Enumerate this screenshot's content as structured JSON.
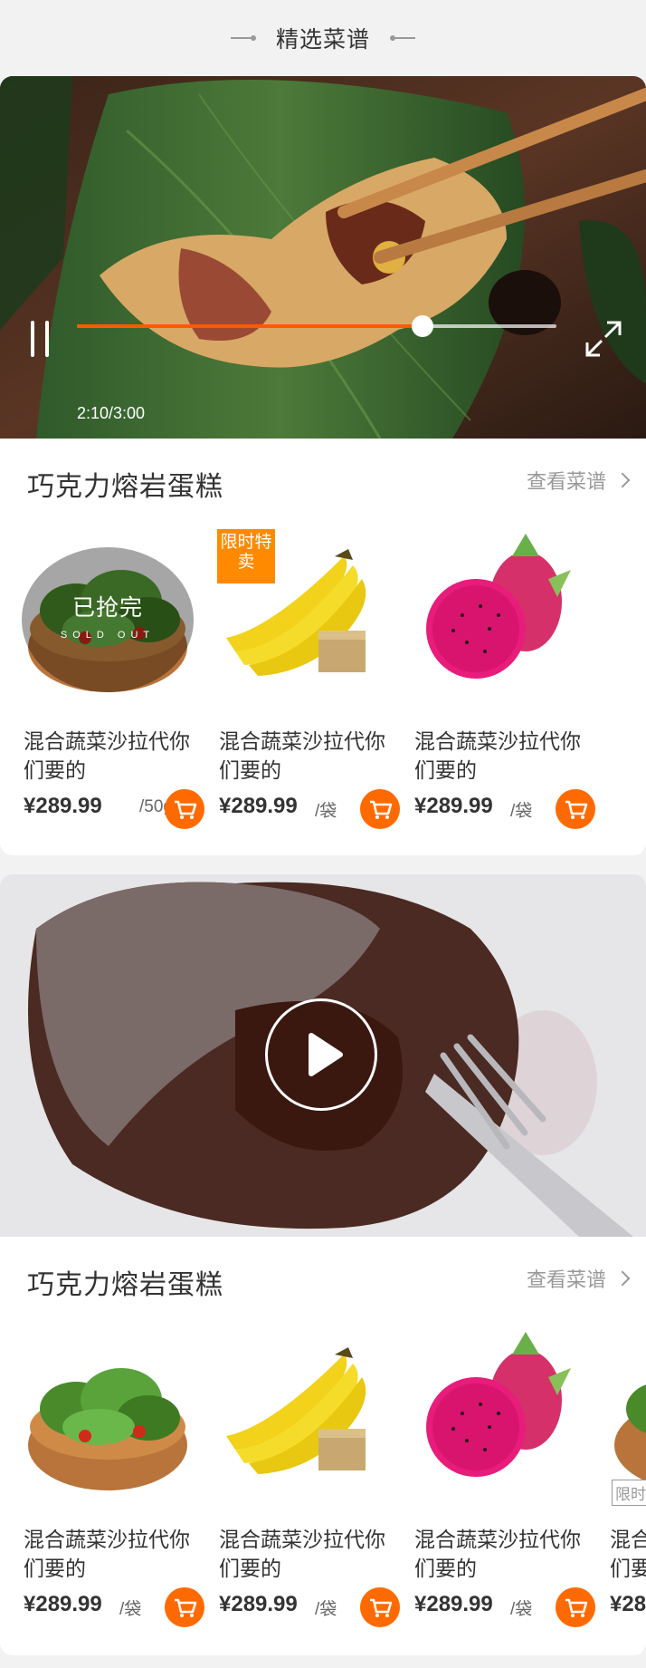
{
  "header": {
    "title": "精选菜谱"
  },
  "player": {
    "time_label": "2:10/3:00",
    "progress": 0.72,
    "accent": "#ff5a00"
  },
  "sections": [
    {
      "title": "巧克力熔岩蛋糕",
      "more_label": "查看菜谱",
      "products": [
        {
          "name": "混合蔬菜沙拉代你们要的",
          "price": "¥289.99",
          "unit": "/50g",
          "image": "salad-bowl",
          "overlay_main": "已抢完",
          "overlay_sub": "SOLD OUT"
        },
        {
          "name": "混合蔬菜沙拉代你们要的",
          "price": "¥289.99",
          "unit": "/袋",
          "image": "bananas",
          "tag": "限时特卖"
        },
        {
          "name": "混合蔬菜沙拉代你们要的",
          "price": "¥289.99",
          "unit": "/袋",
          "image": "dragon-fruit"
        }
      ]
    },
    {
      "title": "巧克力熔岩蛋糕",
      "more_label": "查看菜谱",
      "products": [
        {
          "name": "混合蔬菜沙拉代你们要的",
          "price": "¥289.99",
          "unit": "/袋",
          "image": "salad-bowl"
        },
        {
          "name": "混合蔬菜沙拉代你们要的",
          "price": "¥289.99",
          "unit": "/袋",
          "image": "bananas"
        },
        {
          "name": "混合蔬菜沙拉代你们要的",
          "price": "¥289.99",
          "unit": "/袋",
          "image": "dragon-fruit"
        },
        {
          "name": "混合蔬菜沙拉代你们要的",
          "price": "¥28",
          "unit": "",
          "image": "salad-bowl",
          "tag": "限时"
        }
      ]
    }
  ],
  "icons": {
    "cart": "cart-icon",
    "play": "play-icon",
    "pause": "pause-icon",
    "fullscreen": "fullscreen-icon",
    "chevron": "chevron-right-icon"
  }
}
